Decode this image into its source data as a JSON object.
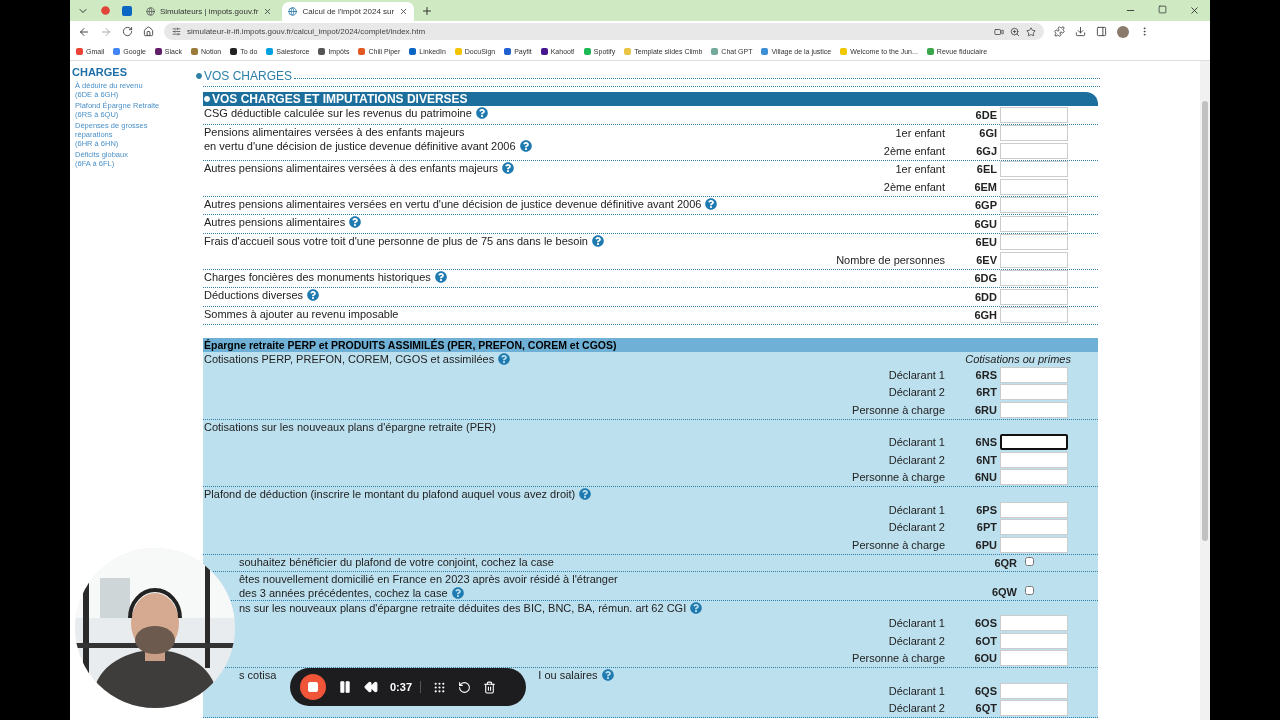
{
  "browser": {
    "tabs": [
      {
        "title": "Simulateurs | impots.gouv.fr",
        "selected": false
      },
      {
        "title": "Calcul de l'impôt 2024 sur",
        "selected": true
      }
    ],
    "url": "simulateur-ir-ifi.impots.gouv.fr/calcul_impot/2024/complet/index.htm",
    "bookmarks": [
      {
        "label": "Gmail",
        "color": "#ea4335"
      },
      {
        "label": "Google",
        "color": "#4285f4"
      },
      {
        "label": "Slack",
        "color": "#611f69"
      },
      {
        "label": "Notion",
        "color": "#9a7b3c"
      },
      {
        "label": "To do",
        "color": "#222222"
      },
      {
        "label": "Salesforce",
        "color": "#00a1e0"
      },
      {
        "label": "Impôts",
        "color": "#555555"
      },
      {
        "label": "Chili Piper",
        "color": "#e25822"
      },
      {
        "label": "LinkedIn",
        "color": "#0a66c2"
      },
      {
        "label": "DocuSign",
        "color": "#f5c400"
      },
      {
        "label": "Payfit",
        "color": "#1f5fd0"
      },
      {
        "label": "Kahoot!",
        "color": "#46178f"
      },
      {
        "label": "Spotify",
        "color": "#1db954"
      },
      {
        "label": "Template slides Climb",
        "color": "#e8c547"
      },
      {
        "label": "Chat GPT",
        "color": "#74aa9c"
      },
      {
        "label": "Village de la justice",
        "color": "#3c8fd6"
      },
      {
        "label": "Welcome to the Jun...",
        "color": "#f0c800"
      },
      {
        "label": "Revue fiduciaire",
        "color": "#3aa64a"
      }
    ]
  },
  "sidebar": {
    "title": "CHARGES",
    "items": [
      {
        "label": "À déduire du revenu",
        "range": "(6DE à 6GH)"
      },
      {
        "label": "Plafond Épargne Retraite",
        "range": "(6RS à 6QU)"
      },
      {
        "label": "Dépenses de grosses réparations",
        "range": "(6HR à 6HN)"
      },
      {
        "label": "Déficits globaux",
        "range": "(6FA à 6FL)"
      }
    ]
  },
  "page_title": "VOS CHARGES",
  "sections": [
    {
      "kind": "plain",
      "title": "VOS CHARGES ET IMPUTATIONS DIVERSES",
      "rows": [
        {
          "kind": "side",
          "covered": false,
          "help": true,
          "label_lines": [
            "CSG déductible calculée sur les revenus du patrimoine"
          ],
          "fields": [
            {
              "kind": "input",
              "code": "6DE",
              "focused": false
            }
          ]
        },
        {
          "kind": "side",
          "covered": false,
          "help": true,
          "label_lines": [
            "Pensions alimentaires versées à des enfants majeurs",
            "en vertu d'une décision de justice devenue définitive avant 2006"
          ],
          "fields": [
            {
              "kind": "input",
              "sublabel": "1er enfant",
              "code": "6GI",
              "focused": false
            },
            {
              "kind": "input",
              "sublabel": "2ème enfant",
              "code": "6GJ",
              "focused": false
            }
          ]
        },
        {
          "kind": "side",
          "covered": false,
          "help": true,
          "label_lines": [
            "Autres pensions alimentaires versées à des enfants majeurs"
          ],
          "fields": [
            {
              "kind": "input",
              "sublabel": "1er enfant",
              "code": "6EL",
              "focused": false
            },
            {
              "kind": "input",
              "sublabel": "2ème enfant",
              "code": "6EM",
              "focused": false
            }
          ]
        },
        {
          "kind": "side",
          "covered": false,
          "help": true,
          "label_lines": [
            "Autres pensions alimentaires versées en vertu d'une décision de justice devenue définitive avant 2006"
          ],
          "fields": [
            {
              "kind": "input",
              "code": "6GP",
              "focused": false
            }
          ]
        },
        {
          "kind": "side",
          "covered": false,
          "help": true,
          "label_lines": [
            "Autres pensions alimentaires"
          ],
          "fields": [
            {
              "kind": "input",
              "code": "6GU",
              "focused": false
            }
          ]
        },
        {
          "kind": "side",
          "covered": false,
          "help": true,
          "label_lines": [
            "Frais d'accueil sous votre toit d'une personne de plus de 75 ans dans le besoin"
          ],
          "fields": [
            {
              "kind": "input",
              "code": "6EU",
              "focused": false
            },
            {
              "kind": "input",
              "sublabel": "Nombre de personnes",
              "code": "6EV",
              "focused": false
            }
          ]
        },
        {
          "kind": "side",
          "covered": false,
          "help": true,
          "label_lines": [
            "Charges foncières des monuments historiques"
          ],
          "fields": [
            {
              "kind": "input",
              "code": "6DG",
              "focused": false
            }
          ]
        },
        {
          "kind": "side",
          "covered": false,
          "help": true,
          "label_lines": [
            "Déductions diverses"
          ],
          "fields": [
            {
              "kind": "input",
              "code": "6DD",
              "focused": false
            }
          ]
        },
        {
          "kind": "side",
          "covered": false,
          "help": false,
          "label_lines": [
            "Sommes à ajouter au revenu imposable"
          ],
          "fields": [
            {
              "kind": "input",
              "code": "6GH",
              "focused": false
            }
          ]
        }
      ]
    },
    {
      "kind": "shaded",
      "title": "Épargne retraite PERP et PRODUITS ASSIMILÉS (PER, PREFON, COREM et CGOS)",
      "column_header": "Cotisations ou primes",
      "rows": [
        {
          "kind": "stacked",
          "covered": false,
          "help": true,
          "label_lines": [
            "Cotisations PERP, PREFON, COREM, CGOS et assimilées"
          ],
          "fields": [
            {
              "kind": "input",
              "sublabel": "Déclarant 1",
              "code": "6RS",
              "focused": false
            },
            {
              "kind": "input",
              "sublabel": "Déclarant 2",
              "code": "6RT",
              "focused": false
            },
            {
              "kind": "input",
              "sublabel": "Personne à charge",
              "code": "6RU",
              "focused": false
            }
          ]
        },
        {
          "kind": "stacked",
          "covered": false,
          "help": false,
          "label_lines": [
            "Cotisations sur les nouveaux plans d'épargne retraite (PER)"
          ],
          "fields": [
            {
              "kind": "input",
              "sublabel": "Déclarant 1",
              "code": "6NS",
              "focused": true
            },
            {
              "kind": "input",
              "sublabel": "Déclarant 2",
              "code": "6NT",
              "focused": false
            },
            {
              "kind": "input",
              "sublabel": "Personne à charge",
              "code": "6NU",
              "focused": false
            }
          ]
        },
        {
          "kind": "stacked",
          "covered": false,
          "help": true,
          "label_lines": [
            "Plafond de déduction (inscrire le montant du plafond auquel vous avez droit)"
          ],
          "fields": [
            {
              "kind": "input",
              "sublabel": "Déclarant 1",
              "code": "6PS",
              "focused": false
            },
            {
              "kind": "input",
              "sublabel": "Déclarant 2",
              "code": "6PT",
              "focused": false
            },
            {
              "kind": "input",
              "sublabel": "Personne à charge",
              "code": "6PU",
              "focused": false
            }
          ]
        },
        {
          "kind": "side",
          "covered": true,
          "help": false,
          "label_lines": [
            "souhaitez bénéficier du plafond de votre conjoint, cochez la case"
          ],
          "fields": [
            {
              "kind": "checkbox",
              "code": "6QR",
              "checked": false
            }
          ]
        },
        {
          "kind": "side",
          "covered": true,
          "help": true,
          "label_lines": [
            "êtes nouvellement domicilié en France en 2023 après avoir résidé à l'étranger",
            "des 3 années précédentes, cochez la case"
          ],
          "fields": [
            {
              "kind": "checkbox",
              "code": "6QW",
              "checked": false
            }
          ]
        },
        {
          "kind": "stacked",
          "covered": true,
          "help": true,
          "label_lines": [
            "ns sur les nouveaux plans d'épargne retraite déduites des BIC, BNC, BA, rémun. art 62 CGI"
          ],
          "fields": [
            {
              "kind": "input",
              "sublabel": "Déclarant 1",
              "code": "6OS",
              "focused": false
            },
            {
              "kind": "input",
              "sublabel": "Déclarant 2",
              "code": "6OT",
              "focused": false
            },
            {
              "kind": "input",
              "sublabel": "Personne à charge",
              "code": "6OU",
              "focused": false
            }
          ]
        },
        {
          "kind": "stacked",
          "covered": true,
          "help": true,
          "label_lines": [
            "s cotisa"
          ],
          "label_tail": "I ou salaires",
          "fields": [
            {
              "kind": "input",
              "sublabel": "Déclarant 1",
              "code": "6QS",
              "focused": false
            },
            {
              "kind": "input",
              "sublabel": "Déclarant 2",
              "code": "6QT",
              "focused": false
            }
          ]
        }
      ]
    }
  ],
  "recorder": {
    "time": "0:37"
  }
}
